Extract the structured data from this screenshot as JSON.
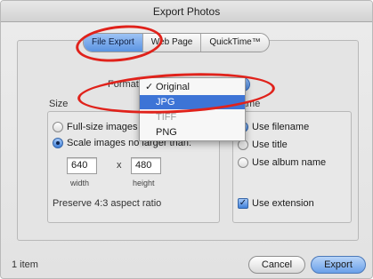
{
  "window": {
    "title": "Export Photos"
  },
  "tabs": [
    {
      "label": "File Export"
    },
    {
      "label": "Web Page"
    },
    {
      "label": "QuickTime™"
    }
  ],
  "format": {
    "label": "Format",
    "menu": [
      {
        "label": "Original",
        "checked": true
      },
      {
        "label": "JPG",
        "highlighted": true
      },
      {
        "label": "TIFF",
        "dim": true
      },
      {
        "label": "PNG"
      }
    ],
    "checkmark": "✓"
  },
  "size": {
    "section_label": "Size",
    "full_size_label": "Full-size images",
    "scale_label": "Scale images no larger than:",
    "width_value": "640",
    "height_value": "480",
    "times_symbol": "x",
    "width_label": "width",
    "height_label": "height",
    "aspect_note": "Preserve 4:3 aspect ratio"
  },
  "name": {
    "section_label": "Name",
    "use_filename": "Use filename",
    "use_title": "Use title",
    "use_album_name": "Use album name",
    "use_extension": "Use extension",
    "check_glyph": "✓"
  },
  "footer": {
    "item_count": "1 item",
    "cancel_label": "Cancel",
    "export_label": "Export"
  },
  "colors": {
    "annotation": "#e0221b",
    "highlight": "#3d74d6"
  }
}
